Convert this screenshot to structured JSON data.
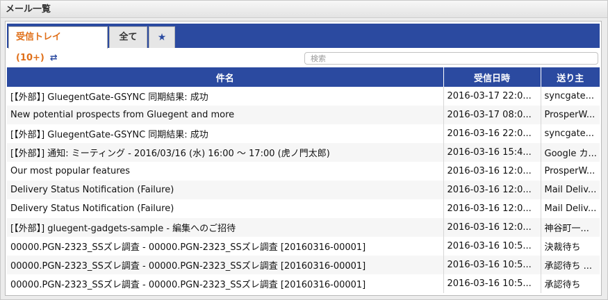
{
  "panel": {
    "title": "メール一覧"
  },
  "tabs": [
    {
      "label": "受信トレイ(10+)",
      "sync_icon": "sync-icon"
    },
    {
      "label": "全て"
    },
    {
      "label": "★",
      "icon": "star-icon"
    }
  ],
  "search": {
    "placeholder": "検索"
  },
  "columns": [
    "件名",
    "受信日時",
    "送り主"
  ],
  "colors": {
    "accent": "#2b4aa0",
    "active_tab_text": "#e0701a"
  },
  "rows": [
    {
      "subject": "[【外部】] GluegentGate-GSYNC 同期結果: 成功",
      "date": "2016-03-17 22:0...",
      "sender": "syncgate..."
    },
    {
      "subject": "New potential prospects from Gluegent and more",
      "date": "2016-03-17 08:0...",
      "sender": "ProsperW..."
    },
    {
      "subject": "[【外部】] GluegentGate-GSYNC 同期結果: 成功",
      "date": "2016-03-16 22:0...",
      "sender": "syncgate..."
    },
    {
      "subject": "[【外部】] 通知: ミーティング - 2016/03/16 (水) 16:00 〜 17:00 (虎ノ門太郎)",
      "date": "2016-03-16 15:4...",
      "sender": "Google カ..."
    },
    {
      "subject": "Our most popular features",
      "date": "2016-03-16 12:0...",
      "sender": "ProsperW..."
    },
    {
      "subject": "Delivery Status Notification (Failure)",
      "date": "2016-03-16 12:0...",
      "sender": "Mail Deliv..."
    },
    {
      "subject": "Delivery Status Notification (Failure)",
      "date": "2016-03-16 12:0...",
      "sender": "Mail Deliv..."
    },
    {
      "subject": "[【外部】] gluegent-gadgets-sample - 編集へのご招待",
      "date": "2016-03-16 12:0...",
      "sender": "神谷町一..."
    },
    {
      "subject": "00000.PGN-2323_SSズレ調査 - 00000.PGN-2323_SSズレ調査 [20160316-00001]",
      "date": "2016-03-16 10:5...",
      "sender": "決裁待ち"
    },
    {
      "subject": "00000.PGN-2323_SSズレ調査 - 00000.PGN-2323_SSズレ調査 [20160316-00001]",
      "date": "2016-03-16 10:5...",
      "sender": "承認待ち ..."
    },
    {
      "subject": "00000.PGN-2323_SSズレ調査 - 00000.PGN-2323_SSズレ調査 [20160316-00001]",
      "date": "2016-03-16 10:5...",
      "sender": "承認待ち"
    }
  ]
}
